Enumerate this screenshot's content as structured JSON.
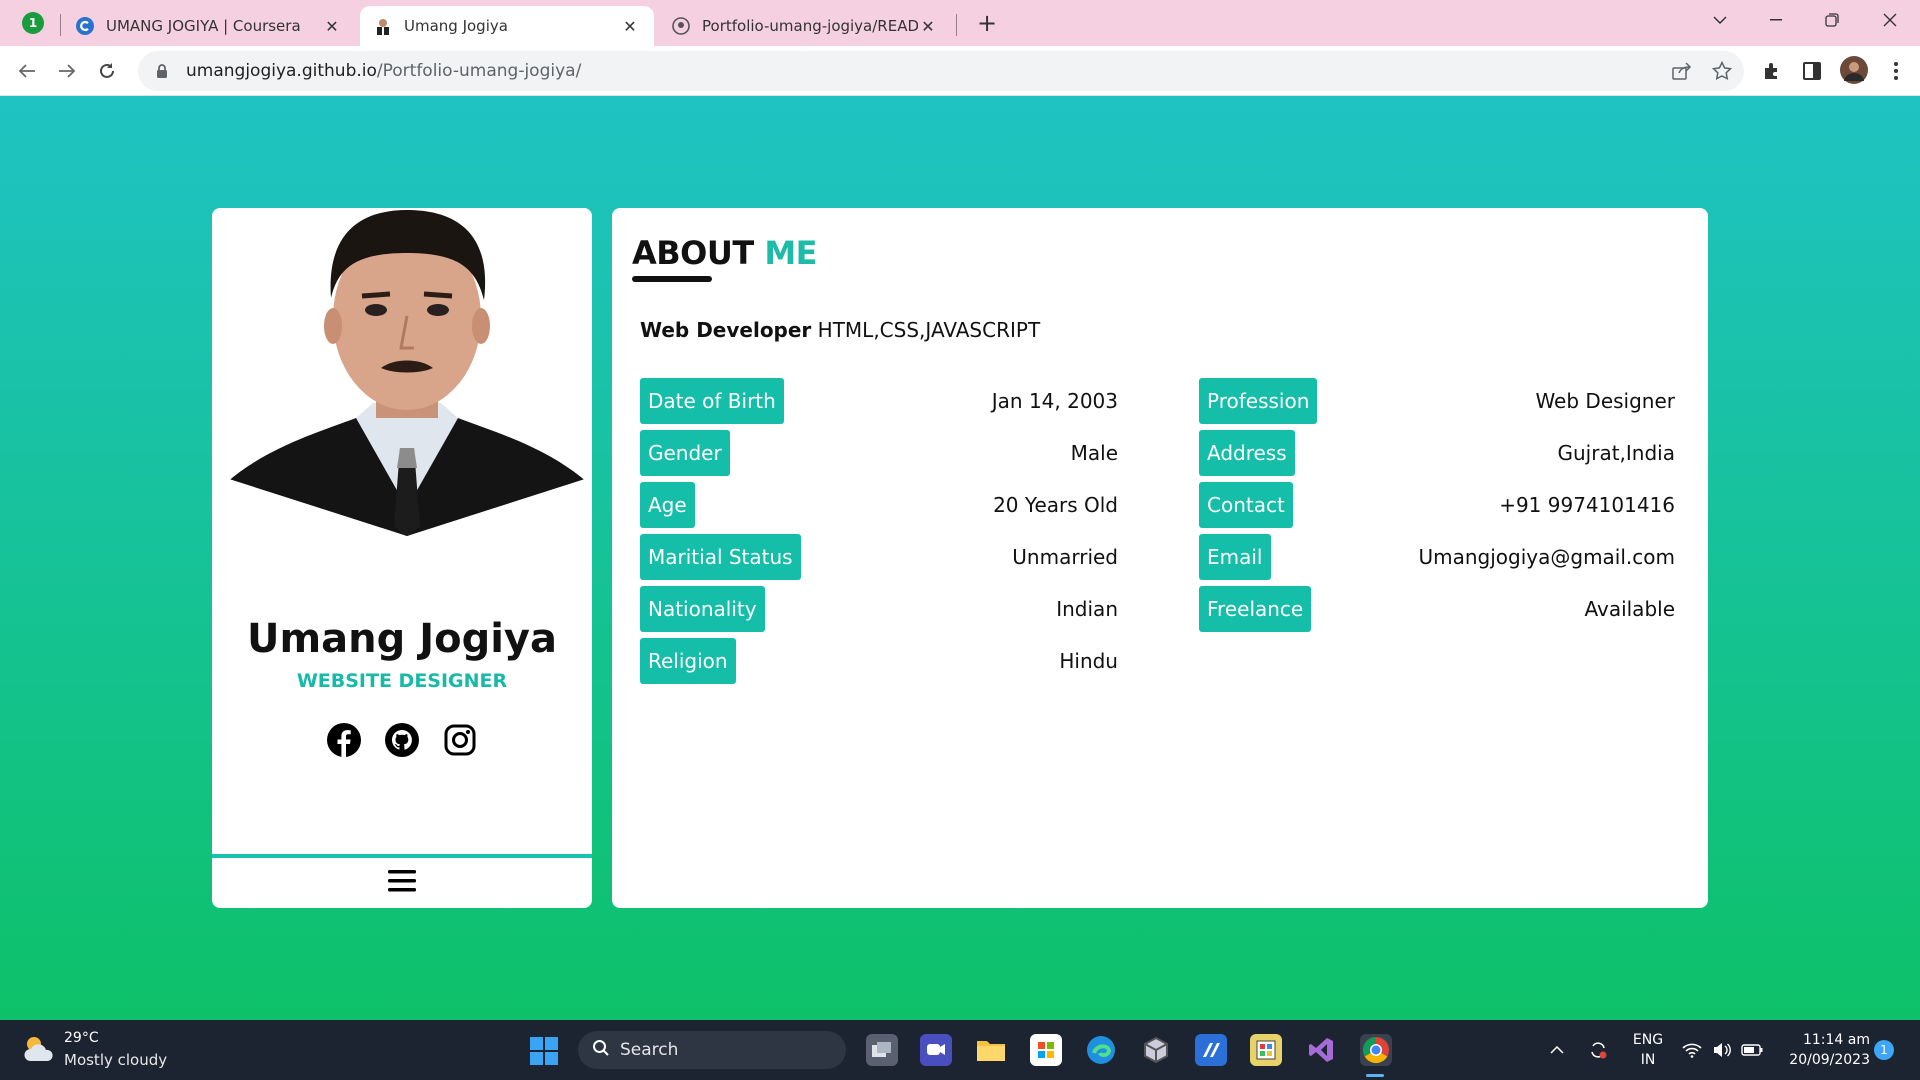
{
  "browser": {
    "extension_badge": "1",
    "tabs": [
      {
        "title": "UMANG JOGIYA | Coursera",
        "close": "✕",
        "active": false
      },
      {
        "title": "Umang Jogiya",
        "close": "✕",
        "active": true
      },
      {
        "title": "Portfolio-umang-jogiya/READM",
        "close": "✕",
        "active": false
      }
    ],
    "new_tab_label": "+",
    "url_host": "umangjogiya.github.io",
    "url_path": "/Portfolio-umang-jogiya/"
  },
  "profile": {
    "name": "Umang Jogiya",
    "role": "WEBSITE DESIGNER",
    "social_icons": [
      "facebook-icon",
      "github-icon",
      "instagram-icon"
    ]
  },
  "about": {
    "title_part1": "ABOUT",
    "title_part2": "ME",
    "headline_bold": "Web Developer",
    "headline_rest": "HTML,CSS,JAVASCRIPT",
    "left_info": [
      {
        "label": "Date of Birth",
        "value": "Jan 14, 2003"
      },
      {
        "label": "Gender",
        "value": "Male"
      },
      {
        "label": "Age",
        "value": "20 Years Old"
      },
      {
        "label": "Maritial Status",
        "value": "Unmarried"
      },
      {
        "label": "Nationality",
        "value": "Indian"
      },
      {
        "label": "Religion",
        "value": "Hindu"
      }
    ],
    "right_info": [
      {
        "label": "Profession",
        "value": "Web Designer"
      },
      {
        "label": "Address",
        "value": "Gujrat,India"
      },
      {
        "label": "Contact",
        "value": "+91 9974101416"
      },
      {
        "label": "Email",
        "value": "Umangjogiya@gmail.com"
      },
      {
        "label": "Freelance",
        "value": "Available"
      }
    ]
  },
  "taskbar": {
    "weather_temp": "29°C",
    "weather_desc": "Mostly cloudy",
    "search_label": "Search",
    "lang_top": "ENG",
    "lang_bottom": "IN",
    "time": "11:14 am",
    "date": "20/09/2023",
    "notification_count": "1"
  },
  "colors": {
    "accent": "#14bea8",
    "gradient_top": "#1fc3c3",
    "gradient_bottom": "#0dc168"
  }
}
